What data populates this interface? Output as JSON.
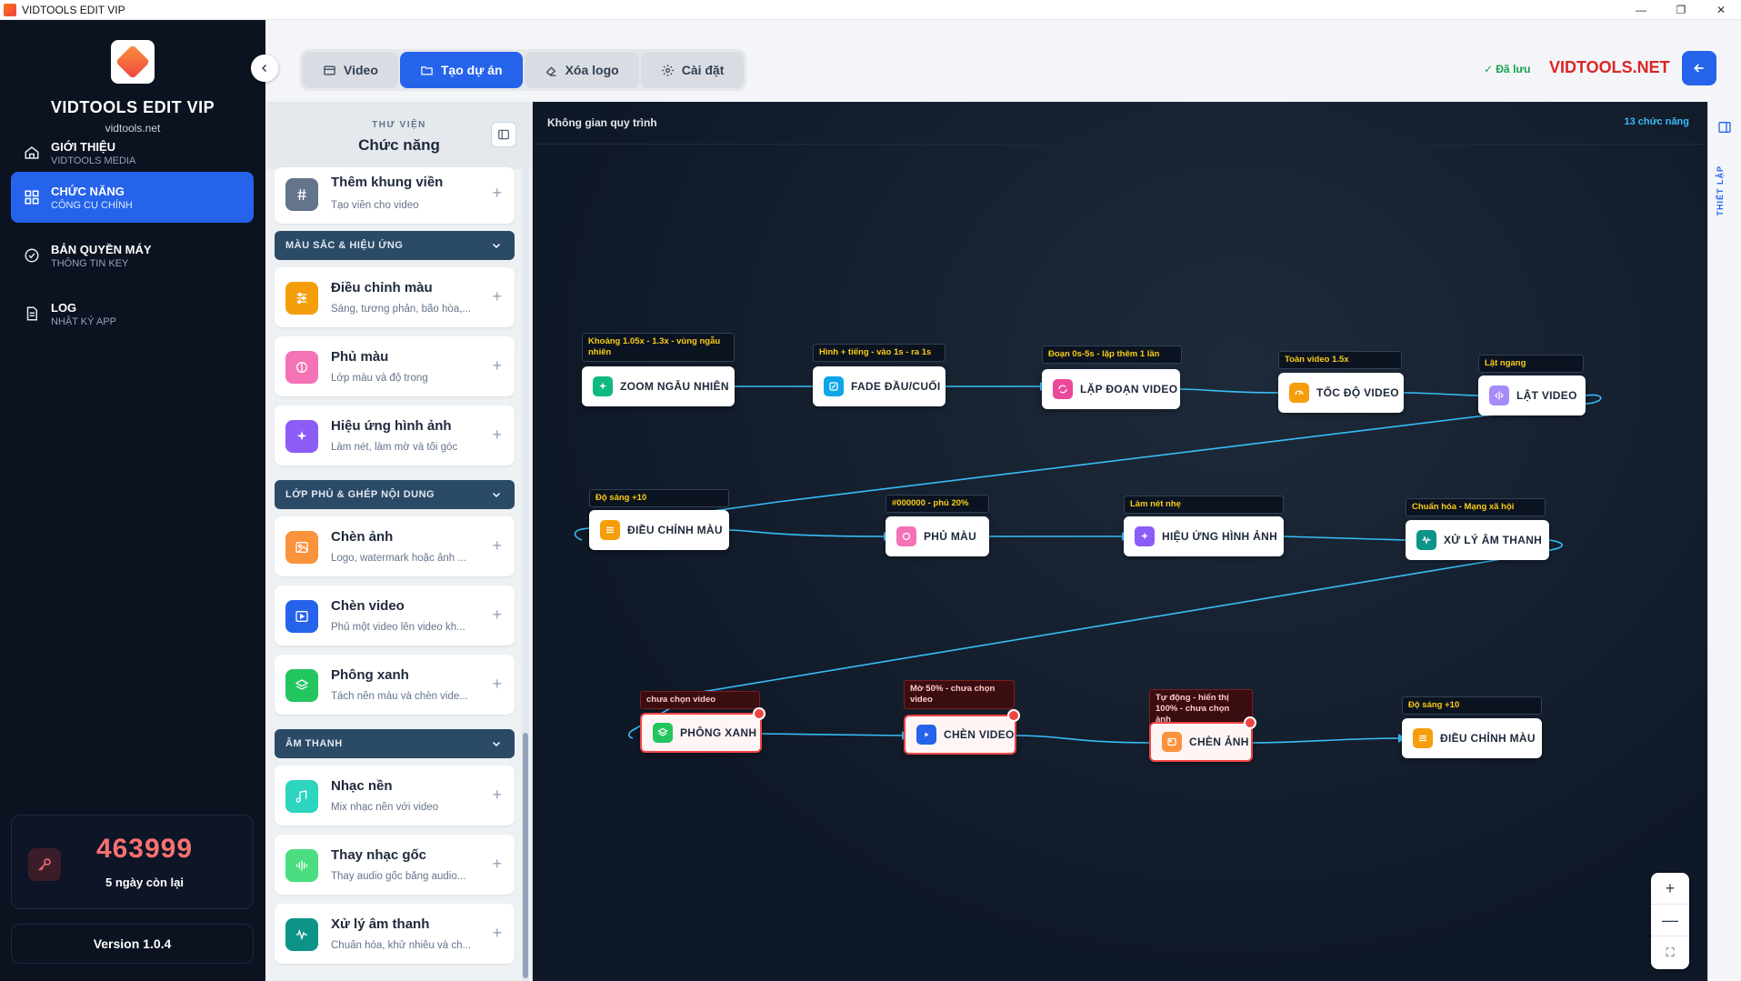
{
  "window": {
    "title": "VIDTOOLS EDIT VIP",
    "controls": [
      "—",
      "❐",
      "✕"
    ]
  },
  "sidebar": {
    "brand": "VIDTOOLS EDIT VIP",
    "site": "vidtools.net",
    "items": [
      {
        "title": "GIỚI THIỆU",
        "sub": "VIDTOOLS MEDIA",
        "icon": "home-icon",
        "active": false
      },
      {
        "title": "CHỨC NĂNG",
        "sub": "CÔNG CỤ CHÍNH",
        "icon": "grid-icon",
        "active": true
      },
      {
        "title": "BẢN QUYỀN MÁY",
        "sub": "THÔNG TIN KEY",
        "icon": "check-circle-icon",
        "active": false
      },
      {
        "title": "LOG",
        "sub": "NHẬT KÝ APP",
        "icon": "document-icon",
        "active": false
      }
    ],
    "key": "463999",
    "days_left": "5 ngày còn lại",
    "version": "Version 1.0.4"
  },
  "topbar": {
    "tabs": [
      {
        "label": "Video",
        "icon": "film-icon",
        "active": false
      },
      {
        "label": "Tạo dự án",
        "icon": "folder-icon",
        "active": true
      },
      {
        "label": "Xóa logo",
        "icon": "eraser-icon",
        "active": false
      },
      {
        "label": "Cài đặt",
        "icon": "gear-icon",
        "active": false
      }
    ],
    "saved": "✓ Đã lưu",
    "site_name": "VIDTOOLS.NET"
  },
  "library": {
    "kicker": "THƯ VIỆN",
    "title": "Chức năng",
    "cards_top": [
      {
        "title": "Thêm khung viền",
        "desc": "Tạo viền cho video",
        "color": "#64748b",
        "icon": "hash-icon"
      }
    ],
    "sections": [
      {
        "label": "MÀU SẮC & HIỆU ỨNG",
        "cards": [
          {
            "title": "Điều chỉnh màu",
            "desc": "Sáng, tương phản, bão hòa,...",
            "color": "#f59e0b",
            "icon": "sliders-icon"
          },
          {
            "title": "Phủ màu",
            "desc": "Lớp màu và độ trong",
            "color": "#f472b6",
            "icon": "droplet-icon"
          },
          {
            "title": "Hiệu ứng hình ảnh",
            "desc": "Làm nét, làm mờ và tối góc",
            "color": "#8b5cf6",
            "icon": "sparkles-icon"
          }
        ]
      },
      {
        "label": "LỚP PHỦ & GHÉP NỘI DUNG",
        "cards": [
          {
            "title": "Chèn ảnh",
            "desc": "Logo, watermark hoặc ảnh ...",
            "color": "#fb923c",
            "icon": "image-icon"
          },
          {
            "title": "Chèn video",
            "desc": "Phủ một video lên video kh...",
            "color": "#2563eb",
            "icon": "play-square-icon"
          },
          {
            "title": "Phông xanh",
            "desc": "Tách nền màu và chèn vide...",
            "color": "#22c55e",
            "icon": "layers-icon"
          }
        ]
      },
      {
        "label": "ÂM THANH",
        "cards": [
          {
            "title": "Nhạc nền",
            "desc": "Mix nhạc nền với video",
            "color": "#2dd4bf",
            "icon": "music-note-icon"
          },
          {
            "title": "Thay nhạc gốc",
            "desc": "Thay audio gốc bằng audio...",
            "color": "#4ade80",
            "icon": "audio-wave-icon"
          },
          {
            "title": "Xử lý âm thanh",
            "desc": "Chuẩn hóa, khử nhiễu và ch...",
            "color": "#0d9488",
            "icon": "waveform-icon"
          }
        ]
      }
    ]
  },
  "canvas": {
    "title": "Không gian quy trình",
    "count": "13 chức năng",
    "nodes": [
      {
        "label": "ZOOM NGẪU NHIÊN",
        "tag": "Khoảng 1.05x - 1.3x - vùng ngẫu nhiên",
        "color": "#10b981",
        "error": false
      },
      {
        "label": "FADE ĐẦU/CUỐI",
        "tag": "Hình + tiếng - vào 1s - ra 1s",
        "color": "#0ea5e9",
        "error": false
      },
      {
        "label": "LẶP ĐOẠN VIDEO",
        "tag": "Đoạn 0s-5s - lặp thêm 1 lần",
        "color": "#ec4899",
        "error": false
      },
      {
        "label": "TỐC ĐỘ VIDEO",
        "tag": "Toàn video 1.5x",
        "color": "#f59e0b",
        "error": false
      },
      {
        "label": "LẬT VIDEO",
        "tag": "Lật ngang",
        "color": "#a78bfa",
        "error": false
      },
      {
        "label": "ĐIỀU CHỈNH MÀU",
        "tag": "Độ sáng +10",
        "color": "#f59e0b",
        "error": false
      },
      {
        "label": "PHỦ MÀU",
        "tag": "#000000 - phủ 20%",
        "color": "#f472b6",
        "error": false
      },
      {
        "label": "HIỆU ỨNG HÌNH ẢNH",
        "tag": "Làm nét nhẹ",
        "color": "#8b5cf6",
        "error": false
      },
      {
        "label": "XỬ LÝ ÂM THANH",
        "tag": "Chuẩn hóa - Mạng xã hội",
        "color": "#0d9488",
        "error": false
      },
      {
        "label": "PHÔNG XANH",
        "tag": "chưa chọn video",
        "color": "#22c55e",
        "error": true
      },
      {
        "label": "CHÈN VIDEO",
        "tag": "Mờ 50% - chưa chọn video",
        "color": "#2563eb",
        "error": true
      },
      {
        "label": "CHÈN ẢNH",
        "tag": "Tự động - hiển thị 100% - chưa chọn ảnh",
        "color": "#fb923c",
        "error": true
      },
      {
        "label": "ĐIỀU CHỈNH MÀU",
        "tag": "Độ sáng +10",
        "color": "#f59e0b",
        "error": false
      }
    ],
    "zoom": [
      "+",
      "—",
      "⛶"
    ]
  },
  "rightpanel": {
    "label": "THIẾT LẬP"
  }
}
